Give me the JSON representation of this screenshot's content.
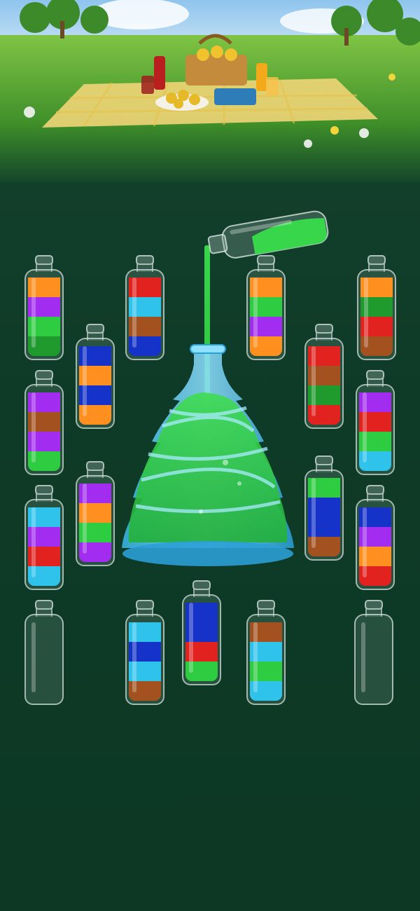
{
  "colors": {
    "orange": "#ff8f1f",
    "purple": "#a22df0",
    "green": "#2ecc40",
    "darkgreen": "#1f9a2d",
    "red": "#e1221f",
    "lightblue": "#2fc2ea",
    "brown": "#a3521f",
    "blue": "#1532c9",
    "pour": "#38d64b"
  },
  "bottles": [
    {
      "id": "b1",
      "layers": [
        "darkgreen",
        "green",
        "purple",
        "orange"
      ]
    },
    {
      "id": "b2",
      "layers": [
        "blue",
        "brown",
        "lightblue",
        "red"
      ]
    },
    {
      "id": "b3",
      "layers": [
        "orange",
        "purple",
        "green",
        "orange"
      ]
    },
    {
      "id": "b4",
      "layers": [
        "brown",
        "red",
        "darkgreen",
        "orange"
      ]
    },
    {
      "id": "b5",
      "layers": [
        "orange",
        "blue",
        "orange",
        "blue"
      ]
    },
    {
      "id": "b6",
      "layers": [
        "red",
        "darkgreen",
        "brown",
        "red"
      ]
    },
    {
      "id": "b7",
      "layers": [
        "green",
        "purple",
        "brown",
        "purple"
      ]
    },
    {
      "id": "b8",
      "layers": [
        "lightblue",
        "green",
        "red",
        "purple"
      ]
    },
    {
      "id": "b9",
      "layers": [
        "purple",
        "green",
        "orange",
        "purple"
      ]
    },
    {
      "id": "b10",
      "layers": [
        "brown",
        "blue",
        "blue",
        "green"
      ]
    },
    {
      "id": "b11",
      "layers": [
        "lightblue",
        "red",
        "purple",
        "lightblue"
      ]
    },
    {
      "id": "b12",
      "layers": [
        "red",
        "orange",
        "purple",
        "blue"
      ]
    },
    {
      "id": "b13",
      "layers": []
    },
    {
      "id": "b14",
      "layers": [
        "green",
        "red",
        "blue",
        "blue"
      ]
    },
    {
      "id": "b15",
      "layers": [
        "brown",
        "lightblue",
        "blue",
        "lightblue"
      ]
    },
    {
      "id": "b16",
      "layers": [
        "lightblue",
        "green",
        "lightblue",
        "brown"
      ]
    },
    {
      "id": "b17",
      "layers": []
    }
  ]
}
